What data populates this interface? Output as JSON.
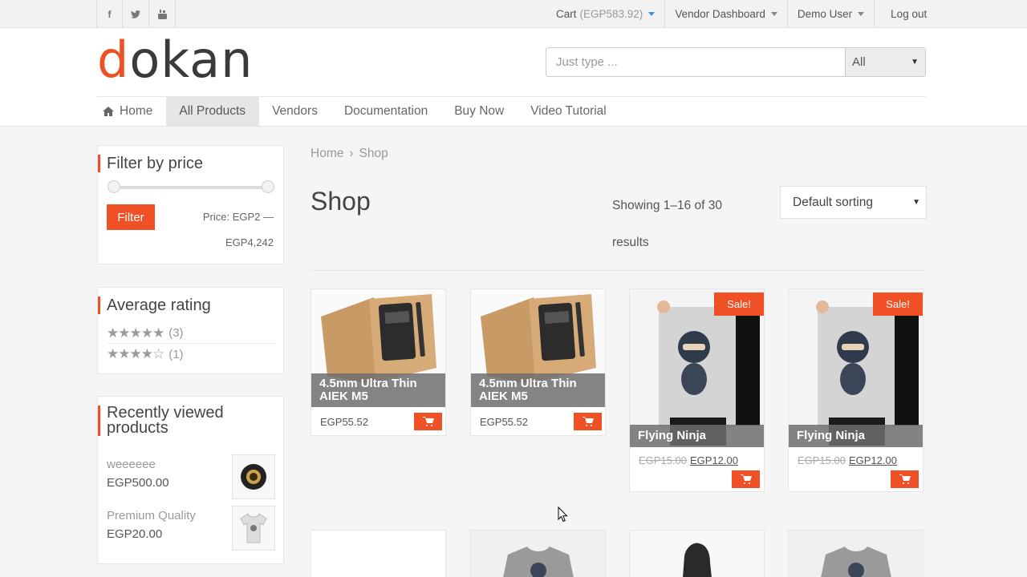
{
  "topbar": {
    "social": [
      {
        "icon": "facebook-icon",
        "glyph": "f"
      },
      {
        "icon": "twitter-icon",
        "glyph": "t"
      },
      {
        "icon": "youtube-icon",
        "glyph": "▶"
      }
    ],
    "cart_label": "Cart",
    "cart_amount": "(EGP583.92)",
    "vendor_dashboard": "Vendor Dashboard",
    "user": "Demo User",
    "logout": "Log out"
  },
  "header": {
    "logo_first": "d",
    "logo_rest": "okan",
    "search_placeholder": "Just type ...",
    "category_selected": "All"
  },
  "nav": {
    "items": [
      "Home",
      "All Products",
      "Vendors",
      "Documentation",
      "Buy Now",
      "Video Tutorial"
    ],
    "active": "All Products"
  },
  "sidebar": {
    "price_filter": {
      "title": "Filter by price",
      "button": "Filter",
      "price_label": "Price: EGP2 —",
      "price_max": "EGP4,242"
    },
    "rating": {
      "title": "Average rating",
      "rows": [
        {
          "stars": "★★★★★",
          "count": "(3)"
        },
        {
          "stars": "★★★★☆",
          "count": "(1)"
        }
      ]
    },
    "recent": {
      "title": "Recently viewed products",
      "items": [
        {
          "name": "weeeeee",
          "price": "EGP500.00"
        },
        {
          "name": "Premium Quality",
          "price": "EGP20.00"
        }
      ]
    }
  },
  "main": {
    "breadcrumb": {
      "home": "Home",
      "sep": "›",
      "current": "Shop"
    },
    "title": "Shop",
    "result_count": "Showing 1–16 of 30 results",
    "sort_selected": "Default sorting",
    "products": [
      {
        "title": "4.5mm Ultra Thin AIEK M5",
        "price": "EGP55.52"
      },
      {
        "title": "4.5mm Ultra Thin AIEK M5",
        "price": "EGP55.52"
      },
      {
        "title": "Flying Ninja",
        "old_price": "EGP15.00",
        "price": "EGP12.00",
        "badge": "Sale!"
      },
      {
        "title": "Flying Ninja",
        "old_price": "EGP15.00",
        "price": "EGP12.00",
        "badge": "Sale!"
      }
    ]
  },
  "colors": {
    "accent": "#f05025",
    "title_overlay": "#6e6e6e",
    "background": "#f5f5f5"
  }
}
